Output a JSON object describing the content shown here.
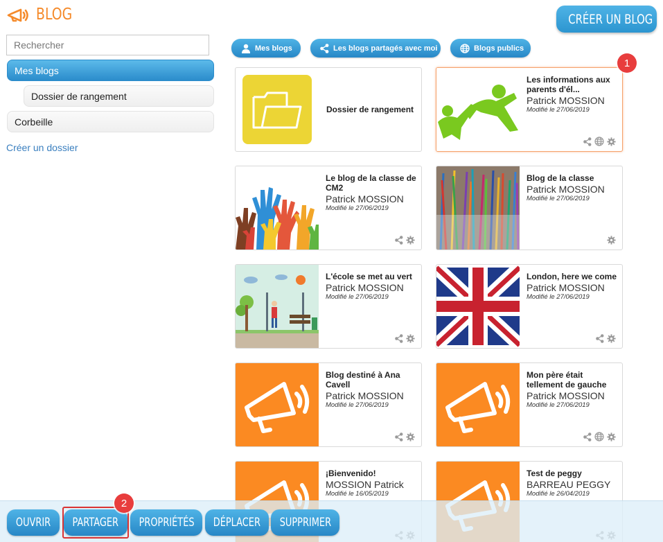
{
  "header": {
    "title": "BLOG",
    "create_button": "CRÉER UN BLOG"
  },
  "sidebar": {
    "search_placeholder": "Rechercher",
    "items": [
      {
        "label": "Mes blogs",
        "active": true
      },
      {
        "label": "Dossier de rangement",
        "active": false
      },
      {
        "label": "Corbeille",
        "active": false
      }
    ],
    "create_folder": "Créer un dossier"
  },
  "filters": [
    {
      "label": "Mes blogs",
      "icon": "user-icon"
    },
    {
      "label": "Les blogs partagés avec moi",
      "icon": "share-icon"
    },
    {
      "label": "Blogs publics",
      "icon": "globe-icon"
    }
  ],
  "folder": {
    "label": "Dossier de rangement",
    "icon": "folder-icon"
  },
  "blogs": [
    {
      "title": "Les informations aux parents d'él...",
      "author": "Patrick MOSSION",
      "date": "Modifié le 27/06/2019",
      "thumb": "people-logo",
      "public": true,
      "actions": [
        "share-icon",
        "globe-icon",
        "gear-icon"
      ]
    },
    {
      "title": "Le blog de la classe de CM2",
      "author": "Patrick MOSSION",
      "date": "Modifié le 27/06/2019",
      "thumb": "raised-hands-image",
      "public": false,
      "actions": [
        "share-icon",
        "gear-icon"
      ]
    },
    {
      "title": "Blog de la classe",
      "author": "Patrick MOSSION",
      "date": "Modifié le 27/06/2019",
      "thumb": "colored-pencils-image",
      "public": false,
      "actions": [
        "gear-icon"
      ]
    },
    {
      "title": "L'école se met au vert",
      "author": "Patrick MOSSION",
      "date": "Modifié le 27/06/2019",
      "thumb": "park-illustration",
      "public": false,
      "actions": [
        "share-icon",
        "gear-icon"
      ]
    },
    {
      "title": "London, here we come",
      "author": "Patrick MOSSION",
      "date": "Modifié le 27/06/2019",
      "thumb": "union-jack-flag",
      "public": false,
      "actions": [
        "share-icon",
        "gear-icon"
      ]
    },
    {
      "title": "Blog destiné à Ana Cavell",
      "author": "Patrick MOSSION",
      "date": "Modifié le 27/06/2019",
      "thumb": "megaphone-icon",
      "public": false,
      "actions": [
        "share-icon",
        "gear-icon"
      ]
    },
    {
      "title": "Mon père était tellement de gauche",
      "author": "Patrick MOSSION",
      "date": "Modifié le 27/06/2019",
      "thumb": "megaphone-icon",
      "public": true,
      "actions": [
        "share-icon",
        "globe-icon",
        "gear-icon"
      ]
    },
    {
      "title": "¡Bienvenido!",
      "author": "MOSSION Patrick",
      "date": "Modifié le 16/05/2019",
      "thumb": "megaphone-icon",
      "public": false,
      "actions": [
        "share-icon",
        "gear-icon"
      ]
    },
    {
      "title": "Test de peggy",
      "author": "BARREAU PEGGY",
      "date": "Modifié le 26/04/2019",
      "thumb": "megaphone-icon",
      "public": false,
      "actions": [
        "share-icon",
        "gear-icon"
      ]
    }
  ],
  "toolbar": {
    "open": "OUVRIR",
    "share": "PARTAGER",
    "properties": "PROPRIÉTÉS",
    "move": "DÉPLACER",
    "delete": "SUPPRIMER"
  },
  "badges": {
    "first": "1",
    "second": "2"
  },
  "colors": {
    "accent_orange": "#f58a2a",
    "button_blue": "#2c95d0",
    "badge_red": "#e83d3d",
    "folder_yellow": "#ecd535",
    "card_orange": "#fb8a22"
  }
}
